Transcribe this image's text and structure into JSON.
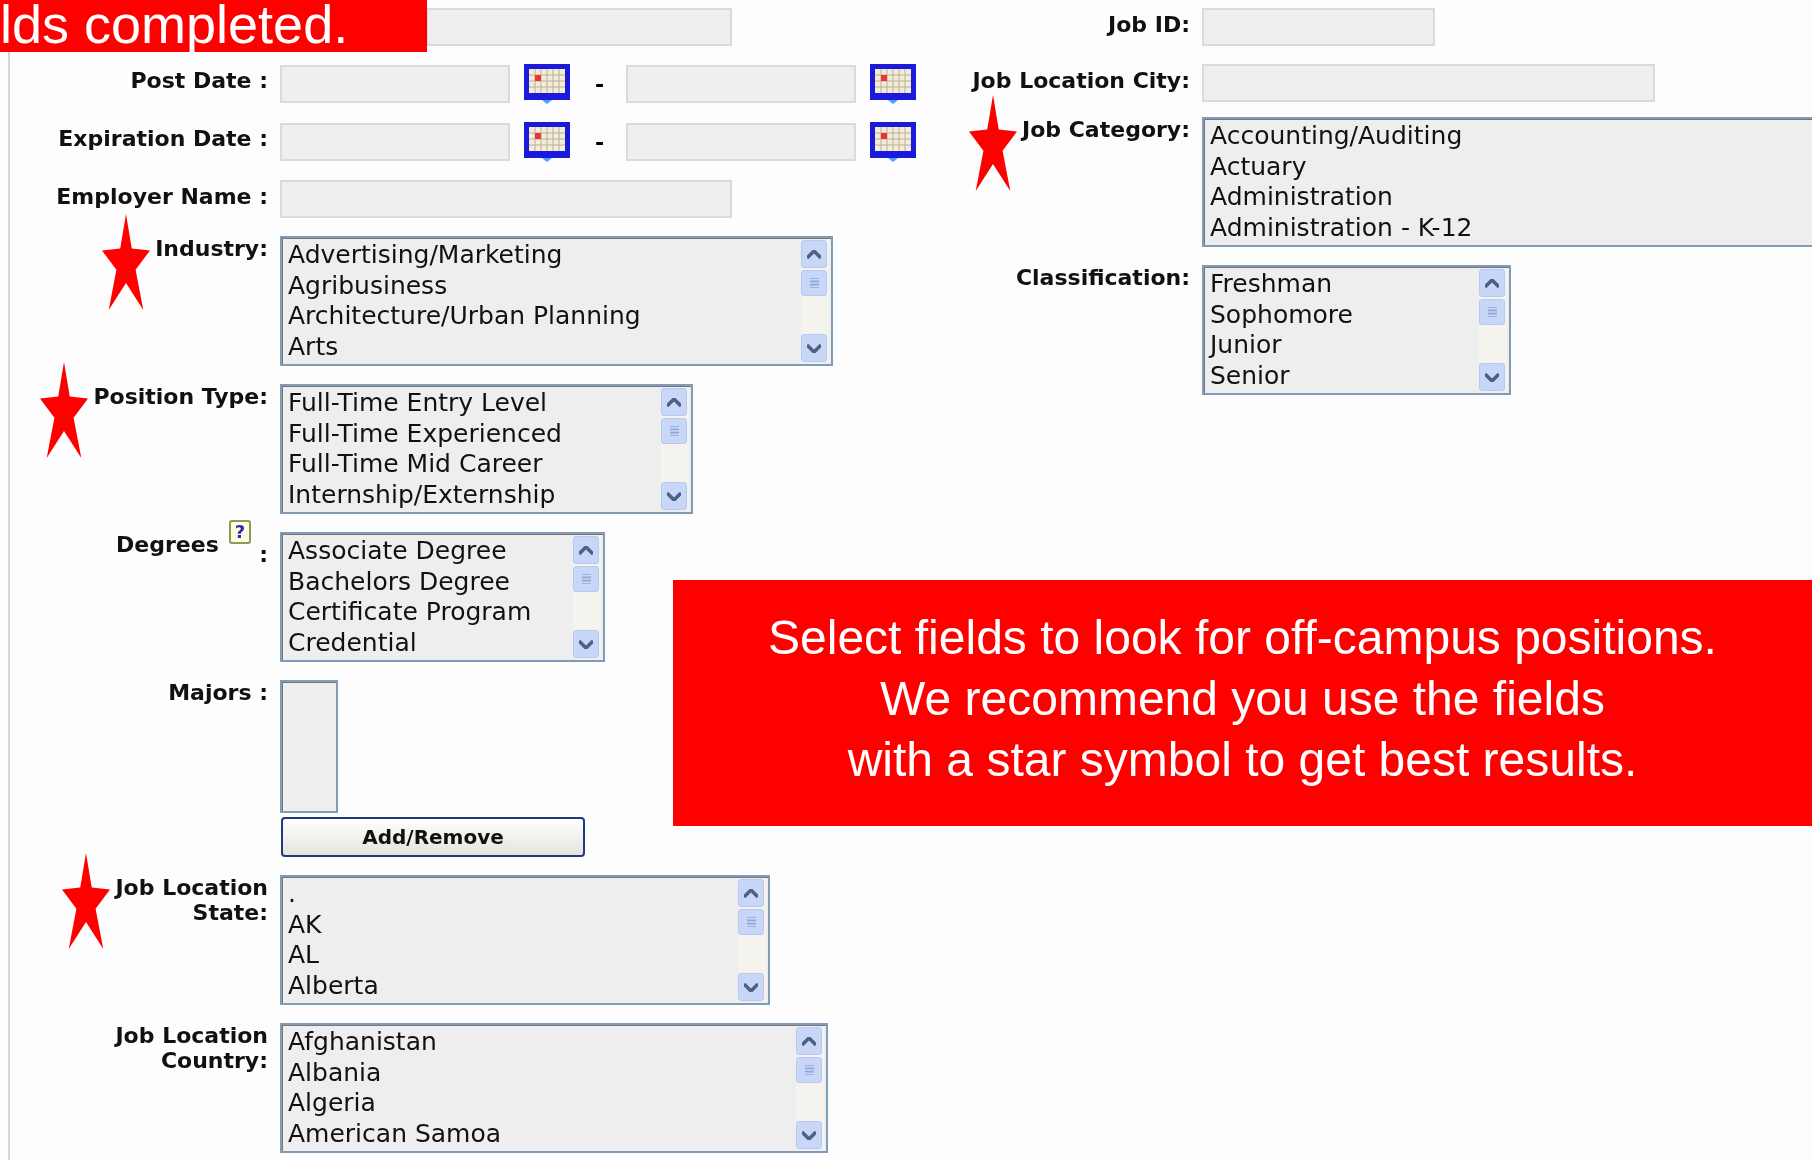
{
  "banner": {
    "text": "lds completed."
  },
  "left_fields": [
    {
      "kind": "blank"
    },
    {
      "kind": "date_range",
      "label_lines": [
        "Post Date :"
      ],
      "separator": "-",
      "starred": false
    },
    {
      "kind": "date_range",
      "label_lines": [
        "Expiration Date :"
      ],
      "separator": "-",
      "starred": false
    },
    {
      "kind": "text",
      "label_lines": [
        "Employer Name :"
      ],
      "starred": false
    },
    {
      "kind": "listbox",
      "label_lines": [
        "Industry:"
      ],
      "starred": true,
      "scrollbar": true,
      "options": [
        "Advertising/Marketing",
        "Agribusiness",
        "Architecture/Urban Planning",
        "Arts"
      ]
    },
    {
      "kind": "listbox",
      "label_lines": [
        "Position Type:"
      ],
      "starred": true,
      "scrollbar": true,
      "options": [
        "Full-Time Entry Level",
        "Full-Time Experienced",
        "Full-Time Mid Career",
        "Internship/Externship"
      ]
    },
    {
      "kind": "listbox",
      "label_lines": [
        "Degrees"
      ],
      "help": "?",
      "label_suffix": ":",
      "starred": false,
      "scrollbar": true,
      "options": [
        "Associate Degree",
        "Bachelors Degree",
        "Certificate Program",
        "Credential"
      ]
    },
    {
      "kind": "picker",
      "label_lines": [
        "Majors :"
      ],
      "starred": false,
      "button": "Add/Remove"
    },
    {
      "kind": "listbox",
      "label_lines": [
        "Job Location",
        "State:"
      ],
      "starred": true,
      "scrollbar": true,
      "options": [
        ".",
        "AK",
        "AL",
        "Alberta"
      ]
    },
    {
      "kind": "listbox",
      "label_lines": [
        "Job Location",
        "Country:"
      ],
      "starred": false,
      "scrollbar": true,
      "options": [
        "Afghanistan",
        "Albania",
        "Algeria",
        "American Samoa"
      ]
    }
  ],
  "right_fields": [
    {
      "kind": "text",
      "label_lines": [
        "Job ID:"
      ],
      "starred": false
    },
    {
      "kind": "text",
      "label_lines": [
        "Job Location City:"
      ],
      "starred": false
    },
    {
      "kind": "listbox",
      "label_lines": [
        "Job Category:"
      ],
      "starred": true,
      "scrollbar": false,
      "options": [
        "Accounting/Auditing",
        "Actuary",
        "Administration",
        "Administration - K-12"
      ]
    },
    {
      "kind": "listbox",
      "label_lines": [
        "Classification:"
      ],
      "starred": false,
      "scrollbar": true,
      "options": [
        "Freshman",
        "Sophomore",
        "Junior",
        "Senior"
      ]
    }
  ],
  "note": {
    "lines": [
      "Select fields to look for off-campus positions.",
      "We recommend you use the fields",
      "with a star symbol to get best results."
    ]
  }
}
